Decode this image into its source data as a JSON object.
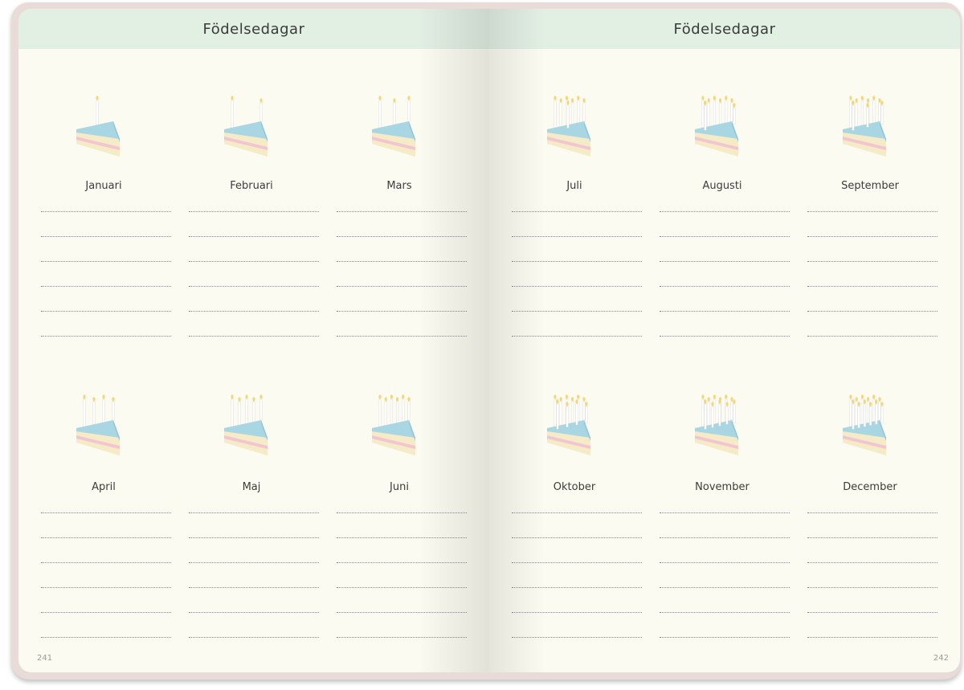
{
  "left_page": {
    "header": "Födelsedagar",
    "page_number": "241",
    "months": [
      {
        "name": "Januari",
        "candles": 1
      },
      {
        "name": "Februari",
        "candles": 2
      },
      {
        "name": "Mars",
        "candles": 3
      },
      {
        "name": "April",
        "candles": 4
      },
      {
        "name": "Maj",
        "candles": 5
      },
      {
        "name": "Juni",
        "candles": 6
      }
    ]
  },
  "right_page": {
    "header": "Födelsedagar",
    "page_number": "242",
    "months": [
      {
        "name": "Juli",
        "candles": 7
      },
      {
        "name": "Augusti",
        "candles": 8
      },
      {
        "name": "September",
        "candles": 9
      },
      {
        "name": "Oktober",
        "candles": 10
      },
      {
        "name": "November",
        "candles": 11
      },
      {
        "name": "December",
        "candles": 12
      }
    ]
  },
  "lines_per_month": 6,
  "colors": {
    "header_band": "#e2efe3",
    "paper": "#fcfbf1",
    "cover": "#e9dcd8",
    "frosting": "#a9d6e3",
    "sponge": "#f6ebc7",
    "filling": "#f2c6d1",
    "candle": "#ffffff",
    "flame": "#f3d77a"
  }
}
